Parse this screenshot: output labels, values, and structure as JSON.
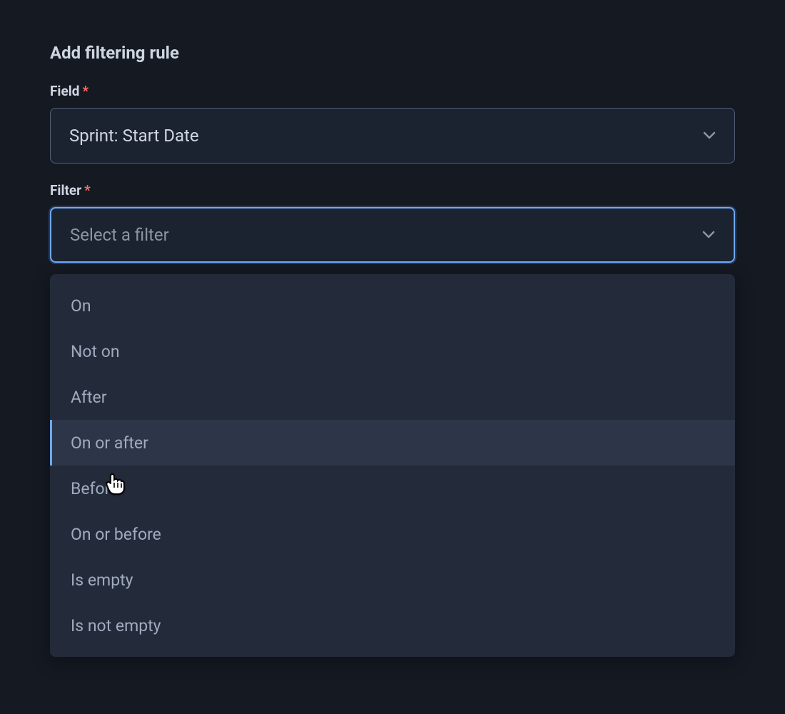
{
  "heading": "Add filtering rule",
  "field": {
    "label": "Field",
    "required": "*",
    "value": "Sprint: Start Date"
  },
  "filter": {
    "label": "Filter",
    "required": "*",
    "placeholder": "Select a filter",
    "options": [
      "On",
      "Not on",
      "After",
      "On or after",
      "Before",
      "On or before",
      "Is empty",
      "Is not empty"
    ],
    "hovered_index": 3
  }
}
